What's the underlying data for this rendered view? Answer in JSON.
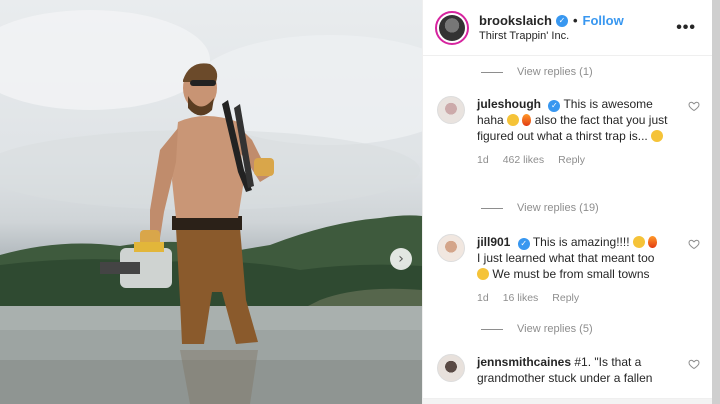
{
  "header": {
    "username": "brookslaich",
    "follow_label": "Follow",
    "separator": "•",
    "location": "Thirst Trappin' Inc.",
    "more_label": "•••"
  },
  "photo": {
    "next_label": "›"
  },
  "comments": [
    {
      "view_replies_before": "View replies (1)"
    },
    {
      "user": "juleshough",
      "text_1": "This is awesome haha",
      "text_2": "also the fact that you just figured out what a thirst trap is...",
      "age": "1d",
      "likes": "462 likes",
      "reply": "Reply",
      "view_replies": "View replies (19)"
    },
    {
      "user": "jill901",
      "text_1": "This is amazing!!!!",
      "text_2": "I just learned what that meant too",
      "text_3": "We must be from small towns",
      "age": "1d",
      "likes": "16 likes",
      "reply": "Reply",
      "view_replies": "View replies (5)"
    },
    {
      "user": "jennsmithcaines",
      "text_1": "#1. \"Is that a grandmother stuck under a fallen"
    }
  ],
  "colors": {
    "accent": "#3897f0",
    "muted": "#8e8e8e",
    "text": "#262626"
  }
}
